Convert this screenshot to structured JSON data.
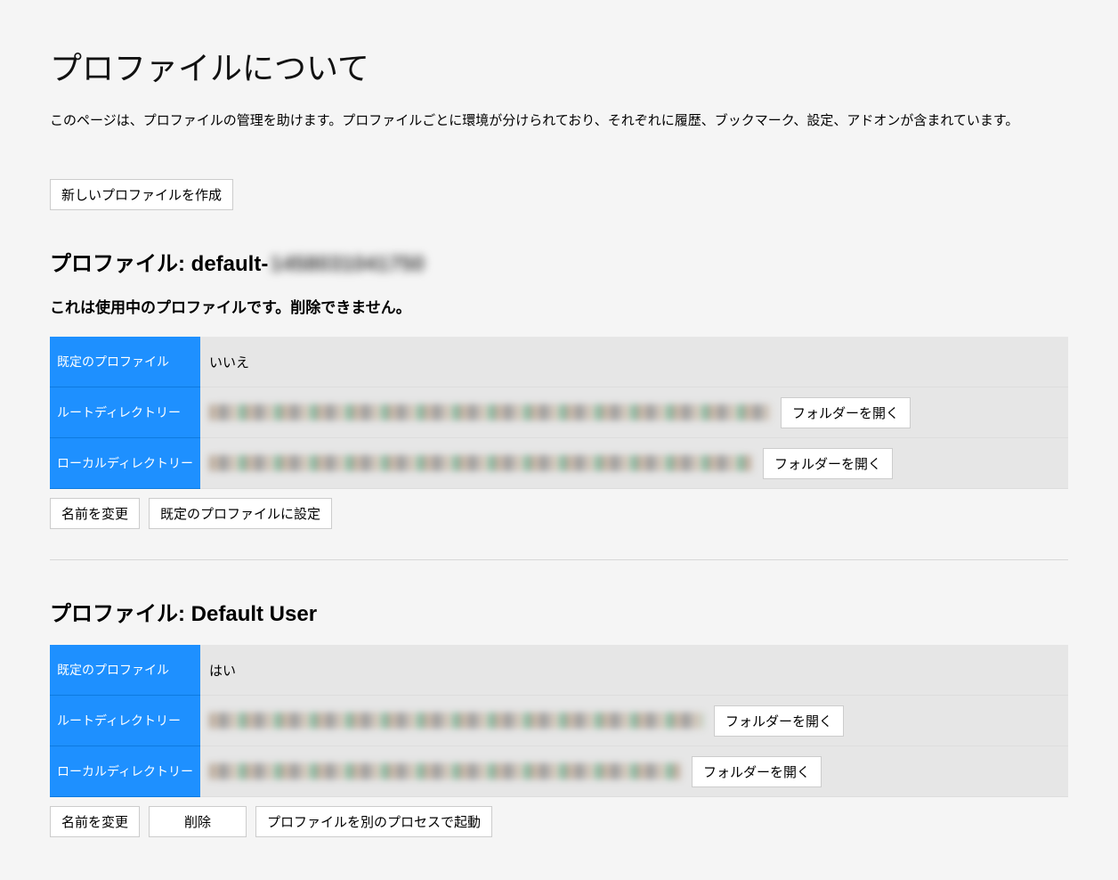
{
  "page": {
    "title": "プロファイルについて",
    "description": "このページは、プロファイルの管理を助けます。プロファイルごとに環境が分けられており、それぞれに履歴、ブックマーク、設定、アドオンが含まれています。"
  },
  "buttons": {
    "create_profile": "新しいプロファイルを作成",
    "open_folder": "フォルダーを開く",
    "rename": "名前を変更",
    "set_default": "既定のプロファイルに設定",
    "delete": "削除",
    "launch_separate": "プロファイルを別のプロセスで起動"
  },
  "labels": {
    "profile_prefix": "プロファイル: ",
    "default_profile": "既定のプロファイル",
    "root_directory": "ルートディレクトリー",
    "local_directory": "ローカルディレクトリー",
    "in_use_note": "これは使用中のプロファイルです。削除できません。"
  },
  "profiles": [
    {
      "name_visible": "default-",
      "name_obscured": "1458031041750",
      "is_default": "いいえ",
      "in_use": true,
      "root_path_width": 630,
      "local_path_width": 610,
      "actions": [
        "rename",
        "set_default"
      ]
    },
    {
      "name_visible": "Default User",
      "name_obscured": "",
      "is_default": "はい",
      "in_use": false,
      "root_path_width": 555,
      "local_path_width": 530,
      "actions": [
        "rename",
        "delete",
        "launch_separate"
      ]
    }
  ]
}
